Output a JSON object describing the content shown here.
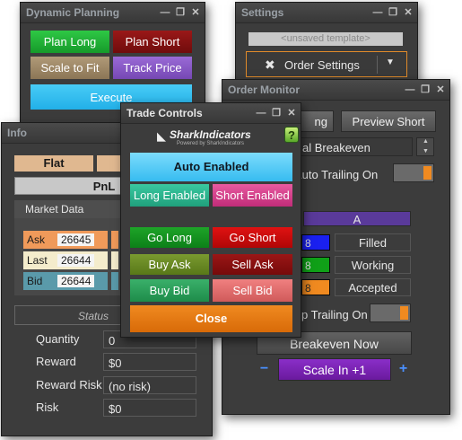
{
  "dynamic_planning": {
    "title": "Dynamic Planning",
    "plan_long": "Plan Long",
    "plan_short": "Plan Short",
    "scale_to_fit": "Scale to Fit",
    "track_price": "Track Price",
    "execute": "Execute"
  },
  "settings": {
    "title": "Settings",
    "template": "<unsaved template>",
    "order_settings": "Order Settings"
  },
  "order_monitor": {
    "title": "Order Monitor",
    "preview_long_partial": "ng",
    "preview_short": "Preview Short",
    "breakeven_partial": "al Breakeven",
    "auto_trailing_on": "Auto Trailing On",
    "account_partial": "A",
    "status_filled": "Filled",
    "status_working": "Working",
    "status_accepted": "Accepted",
    "partial_digit": "8",
    "trailing_on_partial": "p Trailing On",
    "breakeven_now": "Breakeven Now",
    "minus": "−",
    "scale_in": "Scale In +1",
    "plus": "+"
  },
  "info": {
    "title": "Info",
    "position": "Flat",
    "pnl": "PnL",
    "market_data": "Market Data",
    "ask_label": "Ask",
    "ask_value": "26645",
    "last_label": "Last",
    "last_value": "26644",
    "bid_label": "Bid",
    "bid_value": "26644",
    "status": "Status",
    "quantity_label": "Quantity",
    "quantity_value": "0",
    "reward_label": "Reward",
    "reward_value": "$0",
    "reward_risk_label": "Reward Risk",
    "reward_risk_value": "(no risk)",
    "risk_label": "Risk",
    "risk_value": "$0"
  },
  "trade_controls": {
    "title": "Trade Controls",
    "logo": "SharkIndicators",
    "logo_sub": "Powered by SharkIndicators",
    "help": "?",
    "auto_enabled": "Auto Enabled",
    "long_enabled": "Long Enabled",
    "short_enabled": "Short Enabled",
    "go_long": "Go Long",
    "go_short": "Go Short",
    "buy_ask": "Buy Ask",
    "sell_ask": "Sell Ask",
    "buy_bid": "Buy Bid",
    "sell_bid": "Sell Bid",
    "close": "Close"
  },
  "window_buttons": {
    "minimize": "—",
    "restore": "❐",
    "close": "✕"
  },
  "colors": {
    "green": "#18a830",
    "dark_red": "#8a1010",
    "tan": "#a08a6a",
    "purple": "#8a5ac8",
    "cyan": "#30c0f0",
    "orange": "#e87818",
    "teal": "#2aaa8a",
    "magenta": "#d03c8a"
  }
}
